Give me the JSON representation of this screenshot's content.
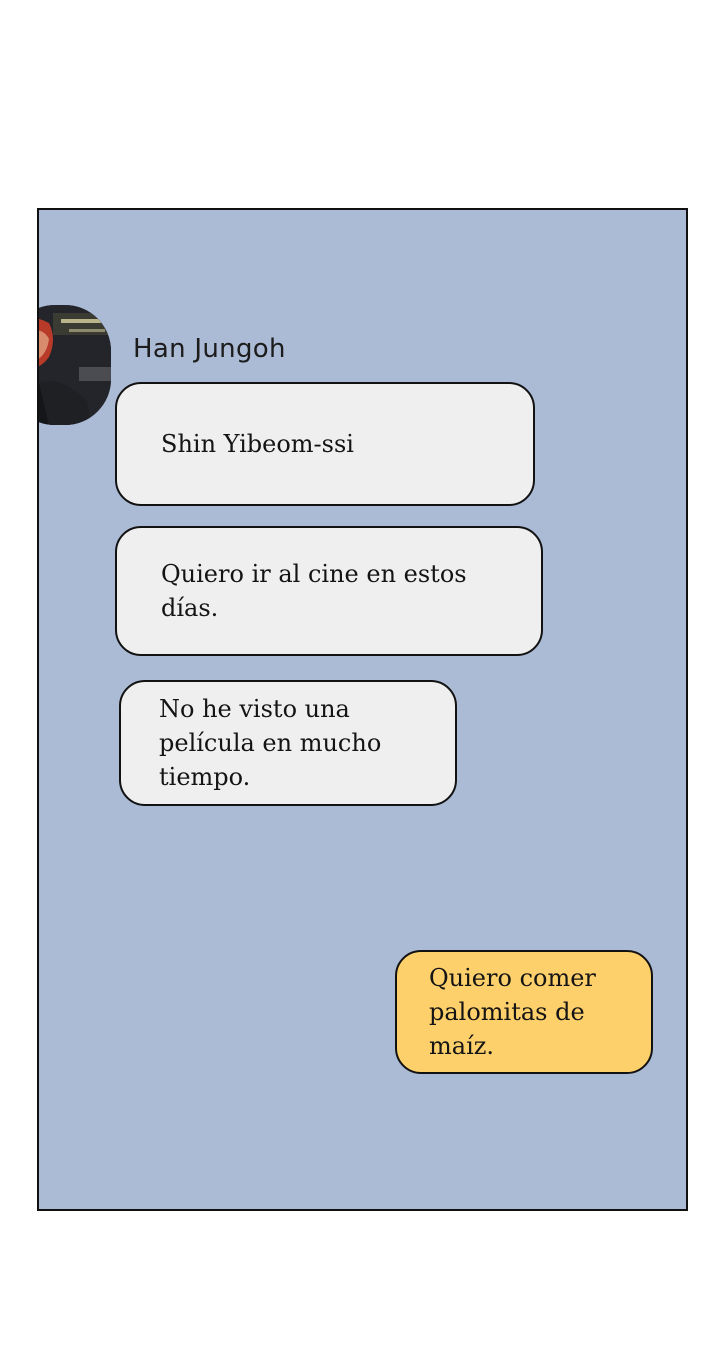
{
  "chat": {
    "contact": {
      "name": "Han Jungoh",
      "avatar_icon": "profile-photo"
    },
    "messages": [
      {
        "from": "contact",
        "text": "Shin Yibeom-ssi"
      },
      {
        "from": "contact",
        "text": "Quiero ir al cine en estos días."
      },
      {
        "from": "contact",
        "text": "No he visto una película en mucho tiempo."
      },
      {
        "from": "me",
        "text": "Quiero comer palomitas de maíz."
      }
    ]
  },
  "colors": {
    "panel_background": "#abbad5",
    "contact_bubble": "#efefef",
    "own_bubble": "#fdd06b",
    "outline": "#121212"
  }
}
